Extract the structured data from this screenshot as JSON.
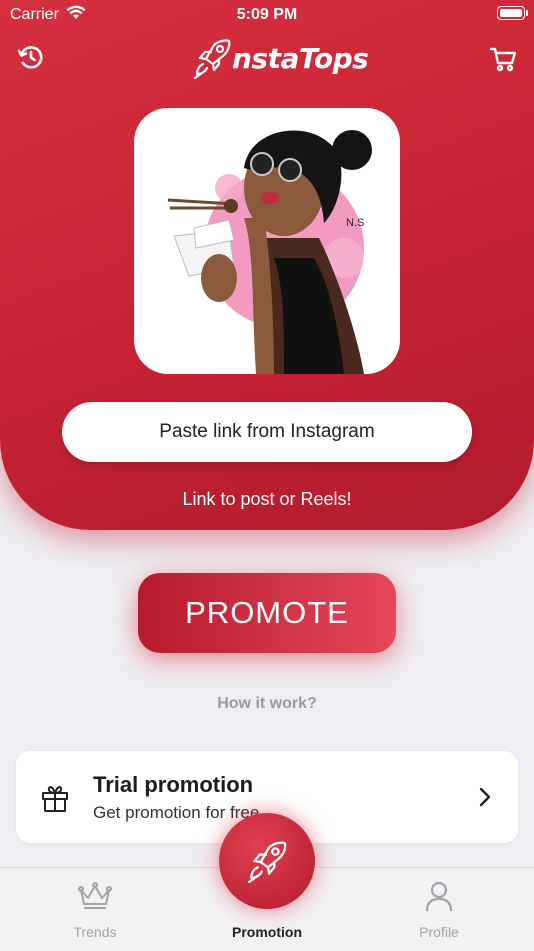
{
  "status_bar": {
    "carrier": "Carrier",
    "time": "5:09 PM"
  },
  "header": {
    "logo_text": "nstaTops"
  },
  "main": {
    "paste_button": "Paste link from Instagram",
    "hint": "Link to post or Reels!",
    "promote_button": "PROMOTE",
    "how_it_works": "How it work?"
  },
  "trial": {
    "title": "Trial promotion",
    "subtitle": "Get promotion for free"
  },
  "tabs": [
    {
      "label": "Trends",
      "icon": "crown-icon"
    },
    {
      "label": "Promotion",
      "icon": "rocket-icon"
    },
    {
      "label": "Profile",
      "icon": "person-icon"
    }
  ],
  "colors": {
    "accent": "#cb2436",
    "accent_light": "#e6475a"
  }
}
